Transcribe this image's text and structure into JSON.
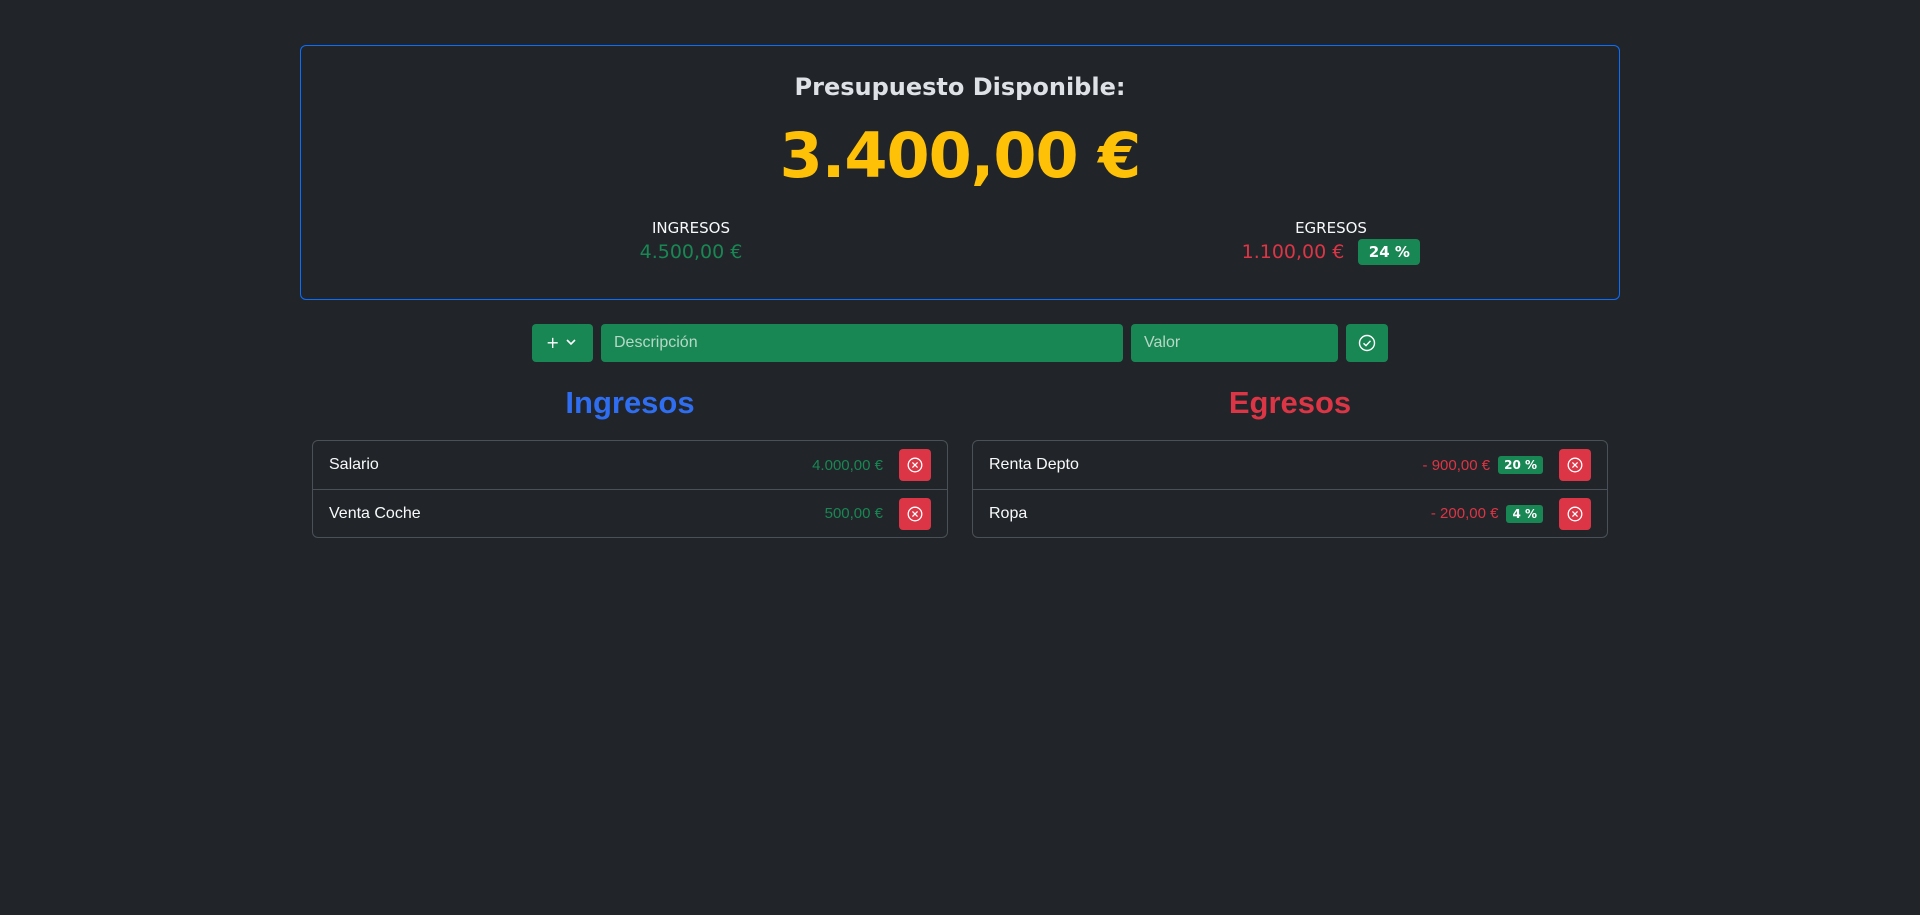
{
  "summary": {
    "title": "Presupuesto Disponible:",
    "amount": "3.400,00 €",
    "income_label": "INGRESOS",
    "income_value": "4.500,00 €",
    "expense_label": "EGRESOS",
    "expense_value": "1.100,00 €",
    "expense_percent": "24 %"
  },
  "form": {
    "type_selected": "+",
    "description_placeholder": "Descripción",
    "value_placeholder": "Valor"
  },
  "income": {
    "title": "Ingresos",
    "items": [
      {
        "description": "Salario",
        "value": "4.000,00 €"
      },
      {
        "description": "Venta Coche",
        "value": "500,00 €"
      }
    ]
  },
  "expense": {
    "title": "Egresos",
    "items": [
      {
        "description": "Renta Depto",
        "value": "- 900,00 €",
        "percent": "20 %"
      },
      {
        "description": "Ropa",
        "value": "- 200,00 €",
        "percent": "4 %"
      }
    ]
  },
  "colors": {
    "background": "#212529",
    "accent_amount": "#ffc107",
    "income": "#198754",
    "expense": "#dc3545",
    "income_title": "#2f6ef0"
  }
}
